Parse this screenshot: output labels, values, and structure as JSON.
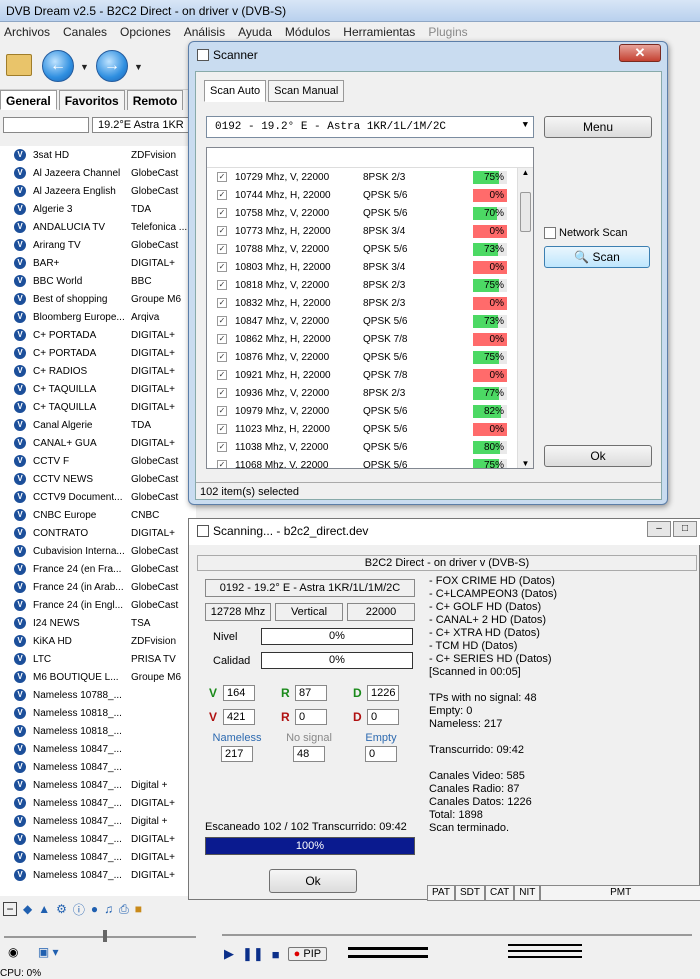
{
  "main_window": {
    "title": "DVB Dream v2.5 - B2C2 Direct - on driver v (DVB-S)",
    "menu": [
      "Archivos",
      "Canales",
      "Opciones",
      "Análisis",
      "Ayuda",
      "Módulos",
      "Herramientas",
      "Plugins"
    ],
    "tabs": [
      "General",
      "Favoritos",
      "Remoto"
    ],
    "satellite": "19.2°E Astra 1KR",
    "channels": [
      {
        "name": "3sat HD",
        "provider": "ZDFvision"
      },
      {
        "name": "Al Jazeera Channel",
        "provider": "GlobeCast"
      },
      {
        "name": "Al Jazeera English",
        "provider": "GlobeCast"
      },
      {
        "name": "Algerie 3",
        "provider": "TDA"
      },
      {
        "name": "ANDALUCIA TV",
        "provider": "Telefonica ..."
      },
      {
        "name": "Arirang TV",
        "provider": "GlobeCast"
      },
      {
        "name": "BAR+",
        "provider": "DIGITAL+"
      },
      {
        "name": "BBC World",
        "provider": "BBC"
      },
      {
        "name": "Best of shopping",
        "provider": "Groupe M6"
      },
      {
        "name": "Bloomberg Europe...",
        "provider": "Arqiva"
      },
      {
        "name": "C+ PORTADA",
        "provider": "DIGITAL+"
      },
      {
        "name": "C+ PORTADA",
        "provider": "DIGITAL+"
      },
      {
        "name": "C+ RADIOS",
        "provider": "DIGITAL+"
      },
      {
        "name": "C+ TAQUILLA",
        "provider": "DIGITAL+"
      },
      {
        "name": "C+ TAQUILLA",
        "provider": "DIGITAL+"
      },
      {
        "name": "Canal Algerie",
        "provider": "TDA"
      },
      {
        "name": "CANAL+ GUA",
        "provider": "DIGITAL+"
      },
      {
        "name": "CCTV F",
        "provider": "GlobeCast"
      },
      {
        "name": "CCTV NEWS",
        "provider": "GlobeCast"
      },
      {
        "name": "CCTV9 Document...",
        "provider": "GlobeCast"
      },
      {
        "name": "CNBC Europe",
        "provider": "CNBC"
      },
      {
        "name": "CONTRATO",
        "provider": "DIGITAL+"
      },
      {
        "name": "Cubavision Interna...",
        "provider": "GlobeCast"
      },
      {
        "name": "France 24 (en Fra...",
        "provider": "GlobeCast"
      },
      {
        "name": "France 24 (in Arab...",
        "provider": "GlobeCast"
      },
      {
        "name": "France 24 (in Engl...",
        "provider": "GlobeCast"
      },
      {
        "name": "I24 NEWS",
        "provider": "TSA"
      },
      {
        "name": "KiKA HD",
        "provider": "ZDFvision"
      },
      {
        "name": "LTC",
        "provider": "PRISA TV"
      },
      {
        "name": "M6 BOUTIQUE L...",
        "provider": "Groupe M6"
      },
      {
        "name": "Nameless 10788_...",
        "provider": ""
      },
      {
        "name": "Nameless 10818_...",
        "provider": ""
      },
      {
        "name": "Nameless 10818_...",
        "provider": ""
      },
      {
        "name": "Nameless 10847_...",
        "provider": ""
      },
      {
        "name": "Nameless 10847_...",
        "provider": ""
      },
      {
        "name": "Nameless 10847_...",
        "provider": "Digital +"
      },
      {
        "name": "Nameless 10847_...",
        "provider": "DIGITAL+"
      },
      {
        "name": "Nameless 10847_...",
        "provider": "Digital +"
      },
      {
        "name": "Nameless 10847_...",
        "provider": "DIGITAL+"
      },
      {
        "name": "Nameless 10847_...",
        "provider": "DIGITAL+"
      },
      {
        "name": "Nameless 10847_...",
        "provider": "DIGITAL+"
      }
    ],
    "status_cpu": "CPU: 0%",
    "pip_label": "PIP"
  },
  "scanner": {
    "title": "Scanner",
    "close_glyph": "✕",
    "tabs": [
      "Scan Auto",
      "Scan Manual"
    ],
    "satellite_combo": "0192 - 19.2° E - Astra 1KR/1L/1M/2C",
    "menu_button": "Menu",
    "network_scan_label": "Network Scan",
    "scan_button": "Scan",
    "ok_button": "Ok",
    "status": "102 item(s) selected",
    "transponders": [
      {
        "freq": "10729 Mhz, V, 22000",
        "mod": "8PSK 2/3",
        "signal": 75
      },
      {
        "freq": "10744 Mhz, H, 22000",
        "mod": "QPSK 5/6",
        "signal": 0
      },
      {
        "freq": "10758 Mhz, V, 22000",
        "mod": "QPSK 5/6",
        "signal": 70
      },
      {
        "freq": "10773 Mhz, H, 22000",
        "mod": "8PSK 3/4",
        "signal": 0
      },
      {
        "freq": "10788 Mhz, V, 22000",
        "mod": "QPSK 5/6",
        "signal": 73
      },
      {
        "freq": "10803 Mhz, H, 22000",
        "mod": "8PSK 3/4",
        "signal": 0
      },
      {
        "freq": "10818 Mhz, V, 22000",
        "mod": "8PSK 2/3",
        "signal": 75
      },
      {
        "freq": "10832 Mhz, H, 22000",
        "mod": "8PSK 2/3",
        "signal": 0
      },
      {
        "freq": "10847 Mhz, V, 22000",
        "mod": "QPSK 5/6",
        "signal": 73
      },
      {
        "freq": "10862 Mhz, H, 22000",
        "mod": "QPSK 7/8",
        "signal": 0
      },
      {
        "freq": "10876 Mhz, V, 22000",
        "mod": "QPSK 5/6",
        "signal": 75
      },
      {
        "freq": "10921 Mhz, H, 22000",
        "mod": "QPSK 7/8",
        "signal": 0
      },
      {
        "freq": "10936 Mhz, V, 22000",
        "mod": "8PSK 2/3",
        "signal": 77
      },
      {
        "freq": "10979 Mhz, V, 22000",
        "mod": "QPSK 5/6",
        "signal": 82
      },
      {
        "freq": "11023 Mhz, H, 22000",
        "mod": "QPSK 5/6",
        "signal": 0
      },
      {
        "freq": "11038 Mhz, V, 22000",
        "mod": "QPSK 5/6",
        "signal": 80
      },
      {
        "freq": "11068 Mhz, V, 22000",
        "mod": "QPSK 5/6",
        "signal": 75
      }
    ],
    "colors": {
      "signal_ok": "#4cd964",
      "signal_none": "#ff6b6b"
    }
  },
  "scanning": {
    "title": "Scanning... - b2c2_direct.dev",
    "header": "B2C2 Direct - on driver v (DVB-S)",
    "satellite": "0192 - 19.2° E - Astra 1KR/1L/1M/2C",
    "frequency": "12728 Mhz",
    "polarization": "Vertical",
    "symbol_rate": "22000",
    "nivel_label": "Nivel",
    "nivel_value": "0%",
    "calidad_label": "Calidad",
    "calidad_value": "0%",
    "counts": {
      "v1": "164",
      "r1": "87",
      "d1": "1226",
      "v2": "421",
      "r2": "0",
      "d2": "0"
    },
    "letters": {
      "v": "V",
      "r": "R",
      "d": "D"
    },
    "nameless_label": "Nameless",
    "nameless_value": "217",
    "nosignal_label": "No signal",
    "nosignal_value": "48",
    "empty_label": "Empty",
    "empty_value": "0",
    "progress_text": "Escaneado 102 / 102    Transcurrido: 09:42",
    "progress_percent": 100,
    "progress_label": "100%",
    "ok_button": "Ok",
    "log": "- FOX CRIME HD (Datos)\n- C+LCAMPEON3 (Datos)\n- C+ GOLF HD (Datos)\n- CANAL+ 2 HD (Datos)\n- C+ XTRA HD (Datos)\n- TCM HD (Datos)\n- C+ SERIES HD (Datos)\n[Scanned in 00:05]\n\nTPs with no signal: 48\nEmpty: 0\nNameless: 217\n\nTranscurrido: 09:42\n\nCanales Video: 585\nCanales Radio: 87\nCanales Datos: 1226\nTotal: 1898\nScan terminado.",
    "pid_tabs": [
      "PAT",
      "SDT",
      "CAT",
      "NIT",
      "PMT"
    ]
  }
}
